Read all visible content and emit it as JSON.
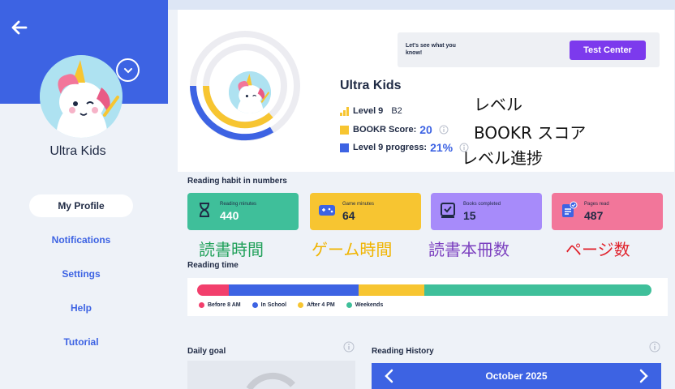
{
  "profile": {
    "name": "Ultra Kids",
    "level_label": "Level 9",
    "level_sub": "B2",
    "score_label": "BOOKR Score:",
    "score_value": "20",
    "progress_label": "Level 9 progress:",
    "progress_value": "21%"
  },
  "annotations": {
    "level": "レベル",
    "score": "BOOKR スコア",
    "progress": "レベル進捗",
    "reading_minutes": "読書時間",
    "game_minutes": "ゲーム時間",
    "books_completed": "読書本冊数",
    "pages_read": "ページ数"
  },
  "nav": {
    "items": [
      {
        "label": "My Profile"
      },
      {
        "label": "Notifications"
      },
      {
        "label": "Settings"
      },
      {
        "label": "Help"
      },
      {
        "label": "Tutorial"
      }
    ]
  },
  "test_center": {
    "prompt": "Let's see what you know!",
    "button_label": "Test Center"
  },
  "habit": {
    "title": "Reading habit in numbers",
    "cards": [
      {
        "label": "Reading minutes",
        "value": "440",
        "color": "#3fbf9a"
      },
      {
        "label": "Game minutes",
        "value": "64",
        "color": "#f7c531"
      },
      {
        "label": "Books completed",
        "value": "15",
        "color": "#a78bfa"
      },
      {
        "label": "Pages read",
        "value": "487",
        "color": "#f2769a"
      }
    ]
  },
  "reading_time": {
    "title": "Reading time",
    "segments": [
      {
        "label": "Before 8 AM",
        "fraction": 0.07,
        "color": "#f23f6c"
      },
      {
        "label": "In School",
        "fraction": 0.285,
        "color": "#3d63e3"
      },
      {
        "label": "After 4 PM",
        "fraction": 0.145,
        "color": "#f7c531"
      },
      {
        "label": "Weekends",
        "fraction": 0.5,
        "color": "#3fbf9a"
      }
    ]
  },
  "daily_goal": {
    "title": "Daily goal"
  },
  "reading_history": {
    "title": "Reading History",
    "month": "October 2025"
  },
  "colors": {
    "primary": "#3d63e3",
    "accent": "#7c3aed",
    "level_yellow": "#f7c531"
  }
}
